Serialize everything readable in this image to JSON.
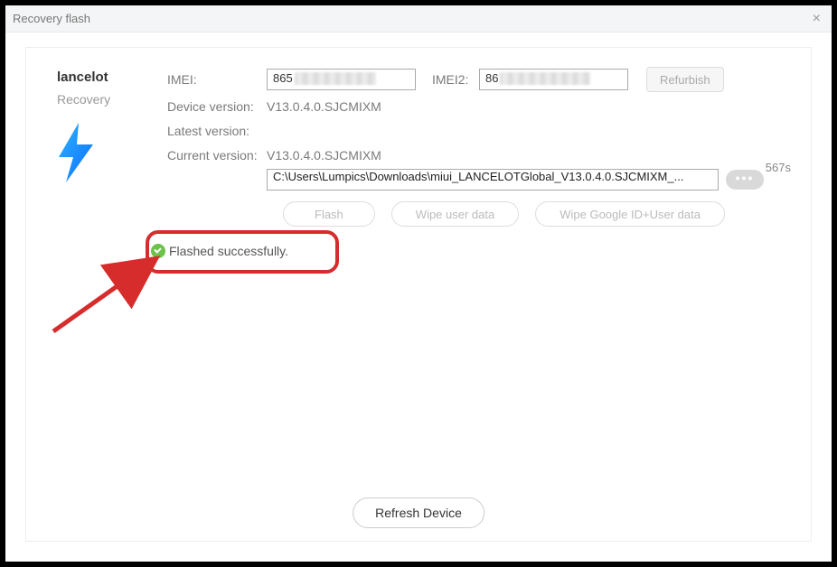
{
  "title": "Recovery flash",
  "device": {
    "name": "lancelot",
    "mode": "Recovery"
  },
  "labels": {
    "imei": "IMEI:",
    "imei2": "IMEI2:",
    "device_version": "Device version:",
    "latest_version": "Latest version:",
    "current_version": "Current version:"
  },
  "values": {
    "imei_prefix": "865",
    "imei2_prefix": "86",
    "device_version": "V13.0.4.0.SJCMIXM",
    "latest_version": "",
    "current_version": "V13.0.4.0.SJCMIXM",
    "path": "C:\\Users\\Lumpics\\Downloads\\miui_LANCELOTGlobal_V13.0.4.0.SJCMIXM_...",
    "timer": "567s"
  },
  "buttons": {
    "refurbish": "Refurbish",
    "flash": "Flash",
    "wipe_user": "Wipe user data",
    "wipe_google": "Wipe Google ID+User data",
    "refresh": "Refresh Device",
    "dots": "•••"
  },
  "status": {
    "message": "Flashed successfully."
  }
}
